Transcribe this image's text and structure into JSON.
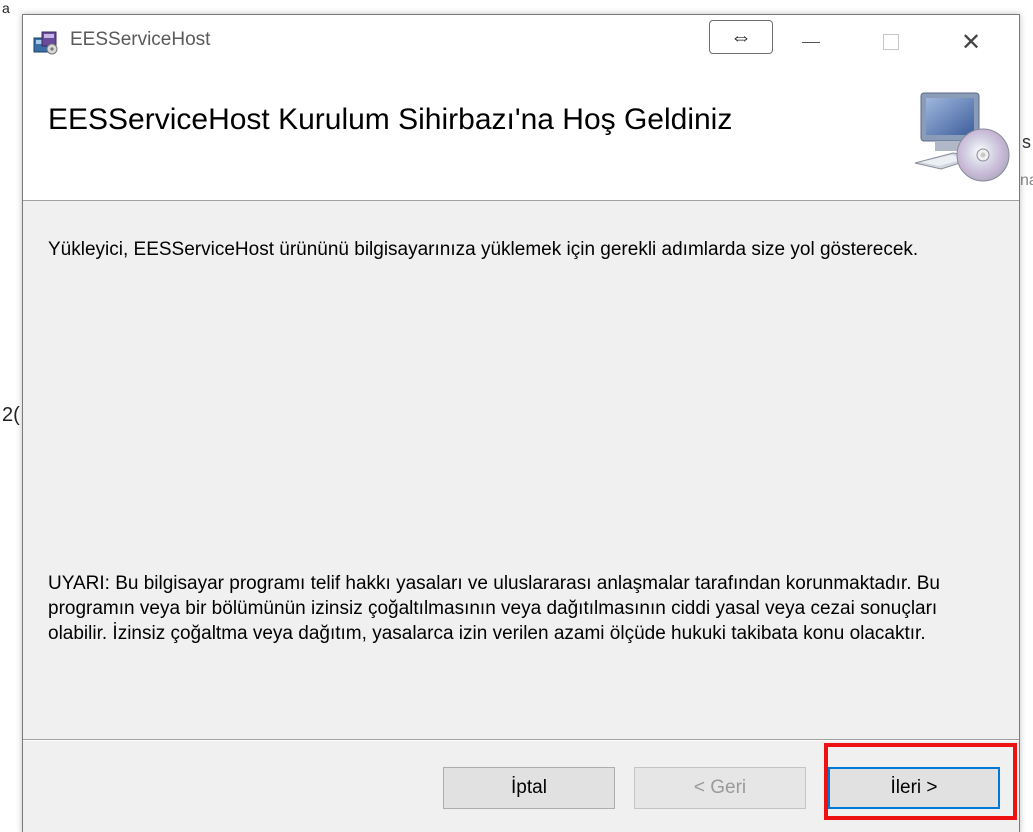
{
  "background": {
    "frag_top": "a",
    "frag_mid": "2(",
    "frag_right1": "s",
    "frag_right2": "na"
  },
  "window": {
    "title": "EESServiceHost",
    "resize_glyph": "⇔",
    "minimize_icon": "minimize-icon",
    "maximize_icon": "maximize-icon",
    "close_glyph": "✕"
  },
  "header": {
    "title": "EESServiceHost Kurulum Sihirbazı'na Hoş Geldiniz"
  },
  "content": {
    "intro": "Yükleyici, EESServiceHost ürününü bilgisayarınıza yüklemek için gerekli adımlarda size yol gösterecek.",
    "warning": "UYARI: Bu bilgisayar programı telif hakkı yasaları ve uluslararası anlaşmalar tarafından korunmaktadır. Bu programın veya bir bölümünün izinsiz çoğaltılmasının veya dağıtılmasının ciddi yasal veya cezai sonuçları olabilir. İzinsiz çoğaltma veya dağıtım, yasalarca izin verilen azami ölçüde hukuki takibata konu olacaktır."
  },
  "buttons": {
    "cancel": "İptal",
    "back": "< Geri",
    "next": "İleri >"
  },
  "colors": {
    "highlight": "#ee1111",
    "focus": "#0078d7"
  }
}
